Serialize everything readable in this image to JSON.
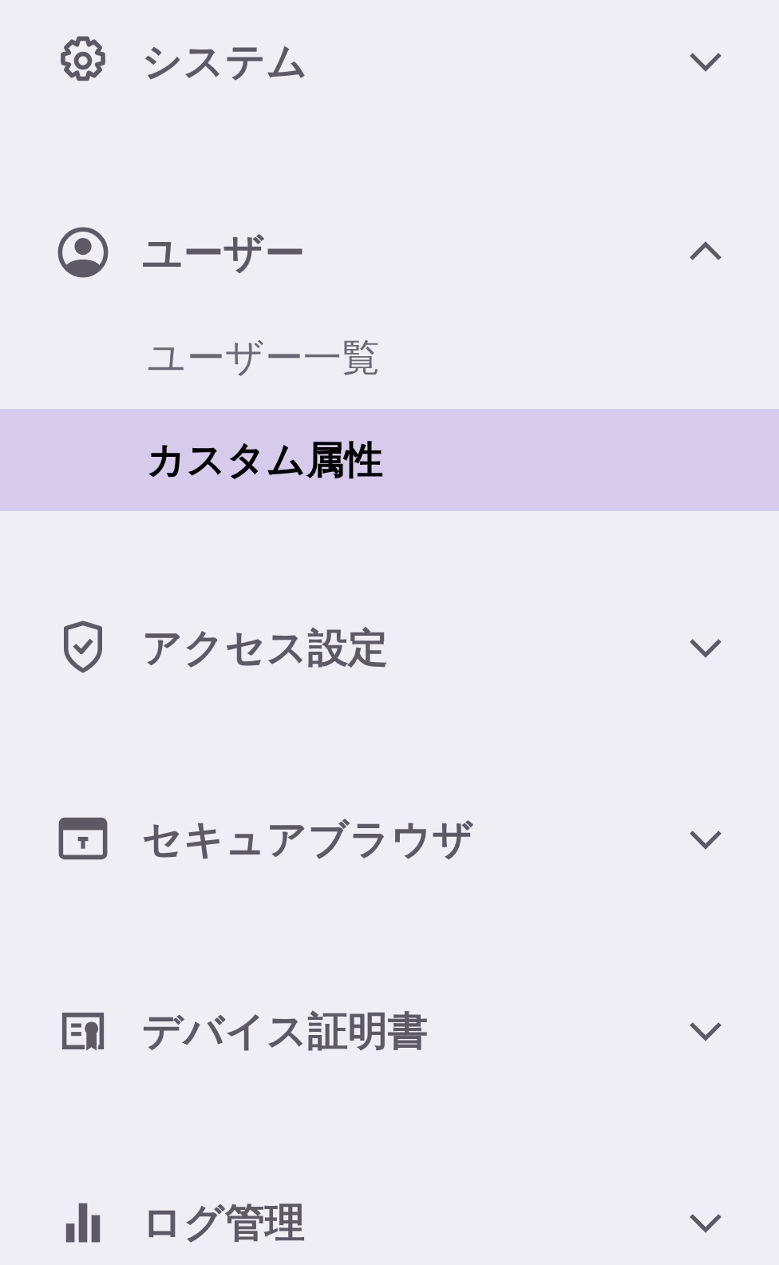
{
  "menu": [
    {
      "label": "システム",
      "expanded": false
    },
    {
      "label": "ユーザー",
      "expanded": true,
      "children": [
        {
          "label": "ユーザー一覧",
          "selected": false
        },
        {
          "label": "カスタム属性",
          "selected": true
        }
      ]
    },
    {
      "label": "アクセス設定",
      "expanded": false
    },
    {
      "label": "セキュアブラウザ",
      "expanded": false
    },
    {
      "label": "デバイス証明書",
      "expanded": false
    },
    {
      "label": "ログ管理",
      "expanded": false
    }
  ]
}
